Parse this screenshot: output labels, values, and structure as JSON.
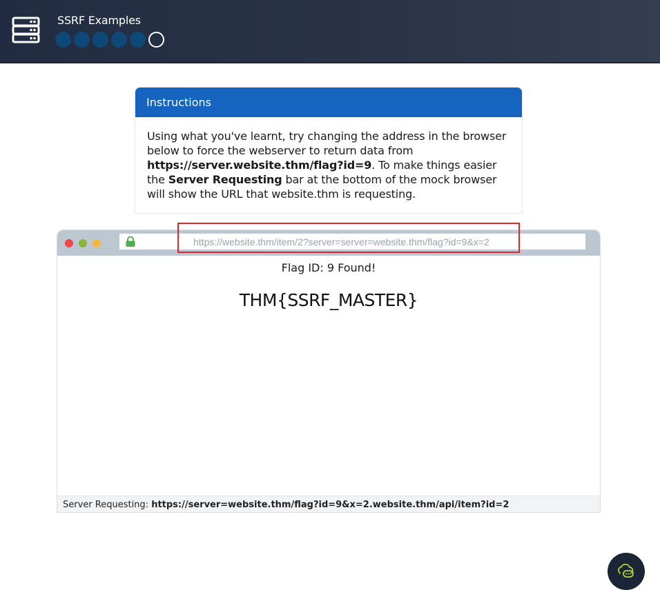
{
  "header": {
    "title": "SSRF Examples",
    "progress": {
      "total": 6,
      "completed": 5,
      "current": 6
    }
  },
  "instructions": {
    "heading": "Instructions",
    "text_1": "Using what you've learnt, try changing the address in the browser below to force the webserver to return data from ",
    "target_url": "https://server.website.thm/flag?id=9",
    "text_2": ". To make things easier the ",
    "bar_name": "Server Requesting",
    "text_3": " bar at the bottom of the mock browser will show the URL that website.thm is requesting."
  },
  "browser": {
    "url": "https://website.thm/item/2?server=server=website.thm/flag?id=9&x=2",
    "flag_status": "Flag ID: 9 Found!",
    "flag_value": "THM{SSRF_MASTER}",
    "status_label": "Server Requesting: ",
    "status_url": "https://server=website.thm/flag?id=9&x=2.website.thm/api/item?id=2"
  },
  "colors": {
    "header_bg": "#2b3447",
    "accent": "#1565c0",
    "highlight": "#e02626",
    "lock": "#4caf50"
  }
}
